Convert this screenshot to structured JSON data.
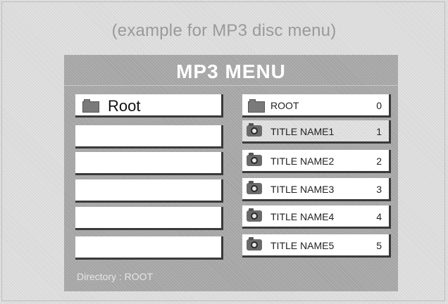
{
  "caption": "(example for MP3 disc menu)",
  "menu": {
    "title": "MP3 MENU",
    "left": {
      "root_label": "Root",
      "icon": "folder-icon"
    },
    "right": {
      "items": [
        {
          "label": "ROOT",
          "number": "0",
          "icon": "folder-icon"
        },
        {
          "label": "TITLE NAME1",
          "number": "1",
          "icon": "camera-icon",
          "selected": true
        },
        {
          "label": "TITLE NAME2",
          "number": "2",
          "icon": "camera-icon"
        },
        {
          "label": "TITLE NAME3",
          "number": "3",
          "icon": "camera-icon"
        },
        {
          "label": "TITLE NAME4",
          "number": "4",
          "icon": "camera-icon"
        },
        {
          "label": "TITLE NAME5",
          "number": "5",
          "icon": "camera-icon"
        }
      ]
    },
    "directory_text": "Directory : ROOT"
  }
}
